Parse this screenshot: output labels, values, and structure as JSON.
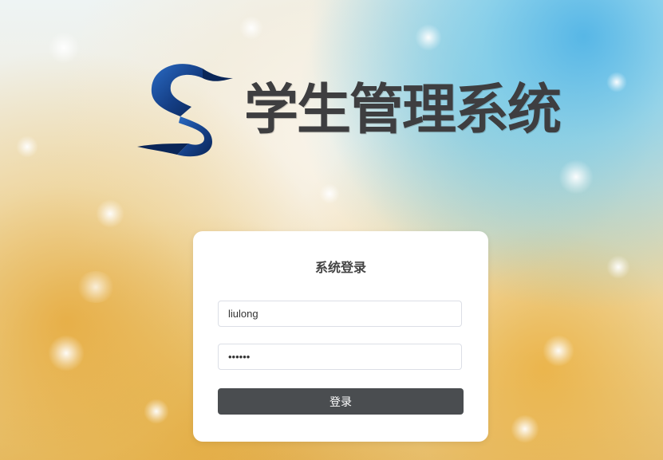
{
  "app": {
    "title": "学生管理系统",
    "logo_icon": "s-logo-icon"
  },
  "login": {
    "heading": "系统登录",
    "username_value": "liulong",
    "password_value": "••••••",
    "submit_label": "登录"
  },
  "colors": {
    "logo_dark_blue": "#0c2f6b",
    "logo_blue": "#1d5aa8",
    "title_text": "#3e3e40",
    "button_bg": "#4a4d50",
    "card_bg": "#ffffff"
  }
}
